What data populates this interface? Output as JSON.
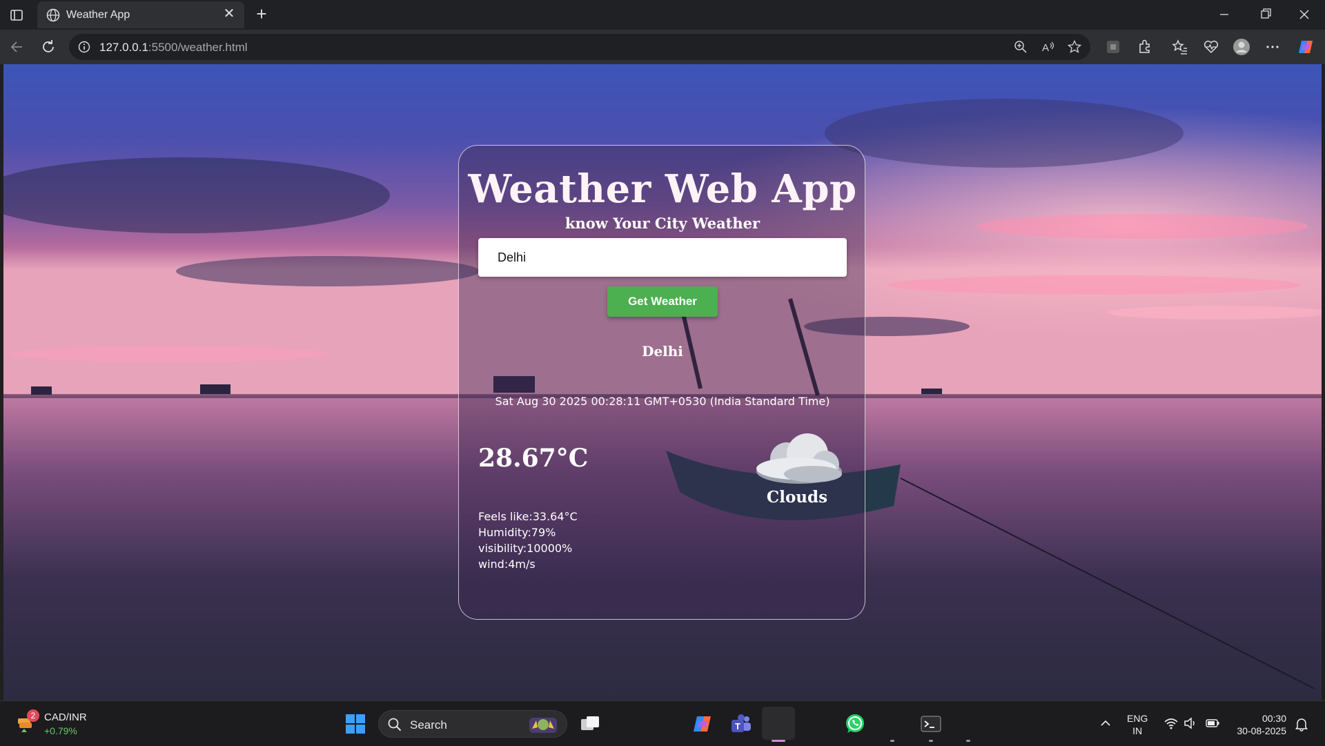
{
  "browser": {
    "tab_title": "Weather App",
    "url_host": "127.0.0.1",
    "url_path": ":5500/weather.html"
  },
  "app": {
    "title": "Weather Web App",
    "subtitle": "know Your City Weather",
    "search_value": "Delhi",
    "button_label": "Get Weather",
    "city": "Delhi",
    "datetime": "Sat Aug 30 2025 00:28:11 GMT+0530 (India Standard Time)",
    "temperature": "28.67°C",
    "condition": "Clouds",
    "condition_icon": "cloud-icon",
    "details": {
      "feels_like": "Feels like:33.64°C",
      "humidity": "Humidity:79%",
      "visibility": "visibility:10000%",
      "wind": "wind:4m/s"
    }
  },
  "taskbar": {
    "stock_name": "CAD/INR",
    "stock_change": "+0.79%",
    "stock_badge": "2",
    "search_label": "Search",
    "lang_top": "ENG",
    "lang_bottom": "IN",
    "time": "00:30",
    "date": "30-08-2025"
  },
  "colors": {
    "button_green": "#4caf50",
    "stock_positive": "#6cc76c"
  }
}
